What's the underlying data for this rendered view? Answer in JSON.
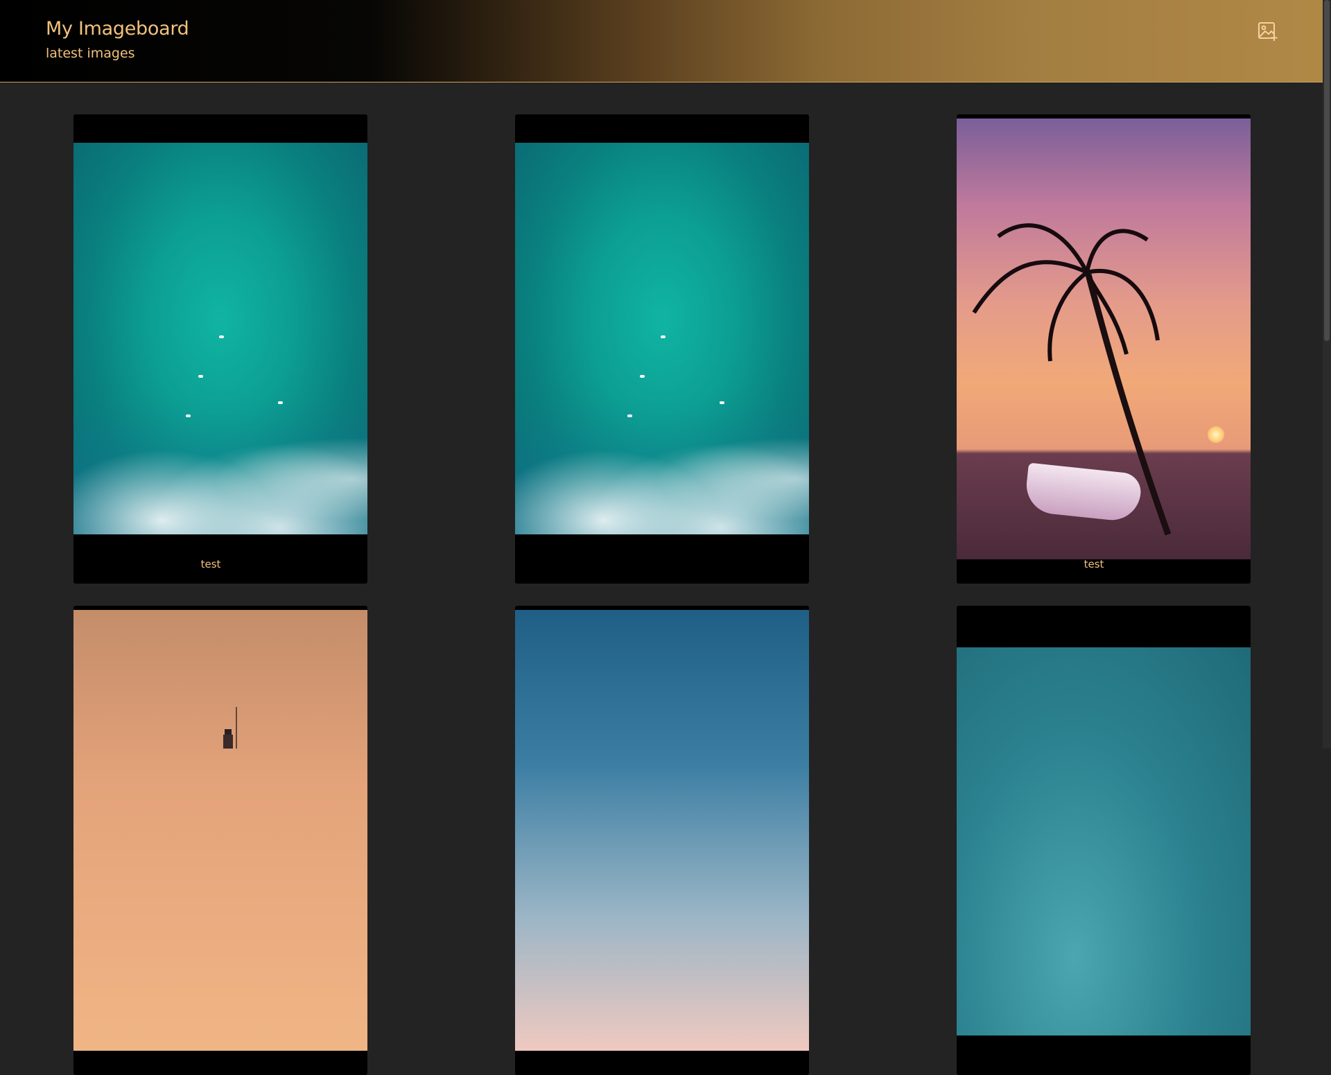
{
  "app": {
    "title": "My Imageboard",
    "subtitle": "latest images"
  },
  "header": {
    "upload_icon": "image-add-icon",
    "accent_color": "#f2c27b"
  },
  "gallery": {
    "cards": [
      {
        "caption": "test",
        "image": "aerial-ocean-surfers"
      },
      {
        "caption": "",
        "image": "aerial-ocean-surfers"
      },
      {
        "caption": "test",
        "image": "palm-tree-boat-sunset"
      },
      {
        "caption": "",
        "image": "lighthouse-dusk"
      },
      {
        "caption": "",
        "image": "blue-gradient-sky"
      },
      {
        "caption": "",
        "image": "teal-water-aerial"
      }
    ]
  }
}
